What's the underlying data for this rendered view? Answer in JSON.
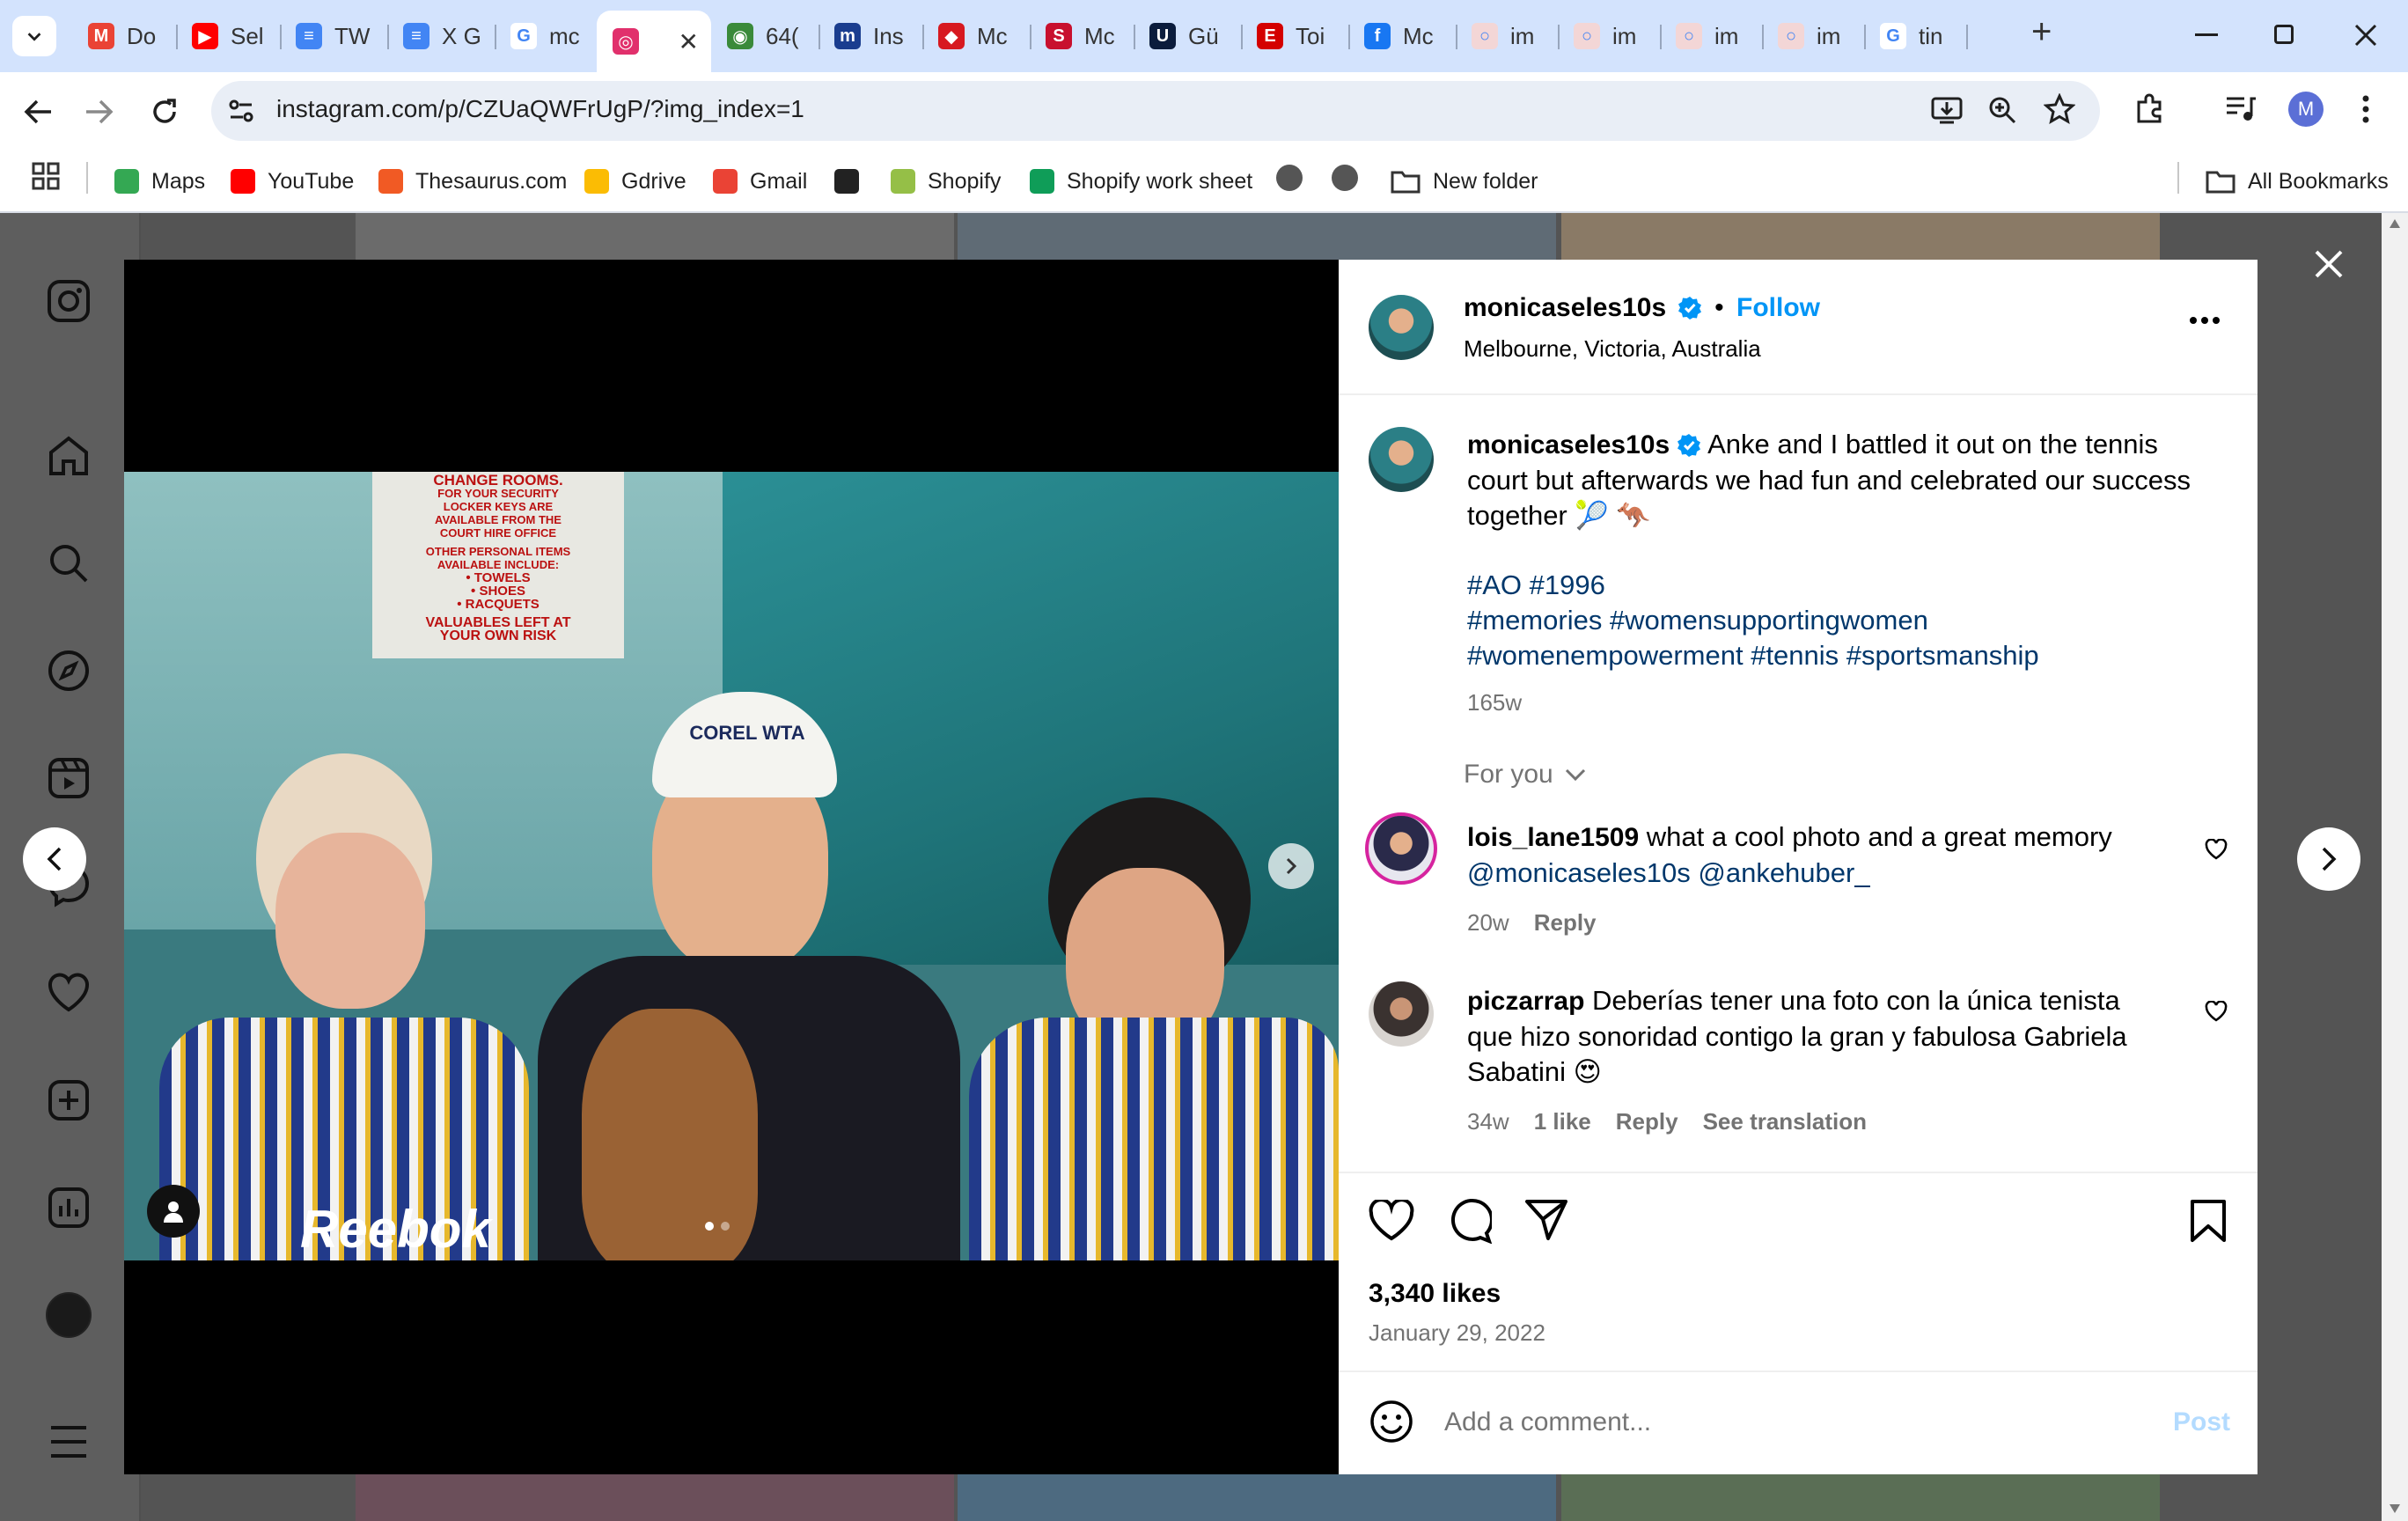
{
  "browser": {
    "tabs": [
      {
        "label": "Do",
        "color": "#ea4335",
        "glyph": "M"
      },
      {
        "label": "Sel",
        "color": "#ff0000",
        "glyph": "▶"
      },
      {
        "label": "TW",
        "color": "#4285f4",
        "glyph": "≡"
      },
      {
        "label": "X G",
        "color": "#4285f4",
        "glyph": "≡"
      },
      {
        "label": "mc",
        "color": "#ffffff",
        "glyph": "G"
      },
      {
        "label": "",
        "color": "#e1306c",
        "glyph": "◎"
      },
      {
        "label": "64(",
        "color": "#3a8a3a",
        "glyph": "◉"
      },
      {
        "label": "Ins",
        "color": "#1a3d8f",
        "glyph": "m"
      },
      {
        "label": "Mc",
        "color": "#d71920",
        "glyph": "◆"
      },
      {
        "label": "Mc",
        "color": "#c8102e",
        "glyph": "S"
      },
      {
        "label": "Gü",
        "color": "#0b1c3c",
        "glyph": "U"
      },
      {
        "label": "Toi",
        "color": "#d40000",
        "glyph": "E"
      },
      {
        "label": "Mc",
        "color": "#1877f2",
        "glyph": "f"
      },
      {
        "label": "im",
        "color": "#f3d6d6",
        "glyph": "○"
      },
      {
        "label": "im",
        "color": "#f3d6d6",
        "glyph": "○"
      },
      {
        "label": "im",
        "color": "#f3d6d6",
        "glyph": "○"
      },
      {
        "label": "im",
        "color": "#f3d6d6",
        "glyph": "○"
      },
      {
        "label": "tin",
        "color": "#ffffff",
        "glyph": "G"
      }
    ],
    "new_tab_label": "+",
    "url": "instagram.com/p/CZUaQWFrUgP/?img_index=1",
    "profile_initial": "M",
    "bookmarks": [
      {
        "label": "Maps",
        "color": "#34a853"
      },
      {
        "label": "YouTube",
        "color": "#ff0000"
      },
      {
        "label": "Thesaurus.com",
        "color": "#f15a24"
      },
      {
        "label": "Gdrive",
        "color": "#fbbc04"
      },
      {
        "label": "Gmail",
        "color": "#ea4335"
      },
      {
        "label": "",
        "color": "#222222"
      },
      {
        "label": "Shopify",
        "color": "#95bf47"
      },
      {
        "label": "Shopify work sheet",
        "color": "#0f9d58"
      }
    ],
    "new_folder_label": "New folder",
    "all_bookmarks_label": "All Bookmarks"
  },
  "post": {
    "username": "monicaseles10s",
    "follow_label": "Follow",
    "location": "Melbourne, Victoria, Australia",
    "caption_text": "Anke and I battled it out on the tennis court but afterwards we had fun and celebrated our success together 🎾 🦘",
    "hashtags_line1": "#AO #1996",
    "hashtags_line2": "#memories #womensupportingwomen",
    "hashtags_line3": "#womenempowerment #tennis #sportsmanship",
    "caption_age": "165w",
    "for_you_label": "For you",
    "comments": [
      {
        "username": "lois_lane1509",
        "text": "what a cool photo and a great memory",
        "mentions": "@monicaseles10s @ankehuber_",
        "age": "20w",
        "likes": "",
        "reply": "Reply",
        "translate": ""
      },
      {
        "username": "piczarrap",
        "text": "Deberías tener una foto con la única tenista que hizo sonoridad contigo la gran y fabulosa Gabriela Sabatini 😍",
        "mentions": "",
        "age": "34w",
        "likes": "1 like",
        "reply": "Reply",
        "translate": "See translation"
      }
    ],
    "likes_count": "3,340 likes",
    "date": "January 29, 2022",
    "comment_placeholder": "Add a comment...",
    "post_label": "Post"
  },
  "photo": {
    "sign_line1": "CHANGE ROOMS.",
    "sign_line2": "FOR YOUR SECURITY",
    "sign_line3": "LOCKER KEYS ARE",
    "sign_line4": "AVAILABLE FROM THE",
    "sign_line5": "COURT HIRE OFFICE",
    "sign_line6": "OTHER PERSONAL ITEMS",
    "sign_line7": "AVAILABLE INCLUDE:",
    "sign_line8": "• TOWELS",
    "sign_line9": "• SHOES",
    "sign_line10": "• RACQUETS",
    "sign_line11": "VALUABLES LEFT AT",
    "sign_line12": "YOUR OWN RISK",
    "cap_logo": "COREL WTA",
    "shirt_text": "Reebok"
  },
  "colors": {
    "instagram_blue": "#0095f6",
    "hashtag_blue": "#00376b",
    "overlay": "#545454"
  }
}
